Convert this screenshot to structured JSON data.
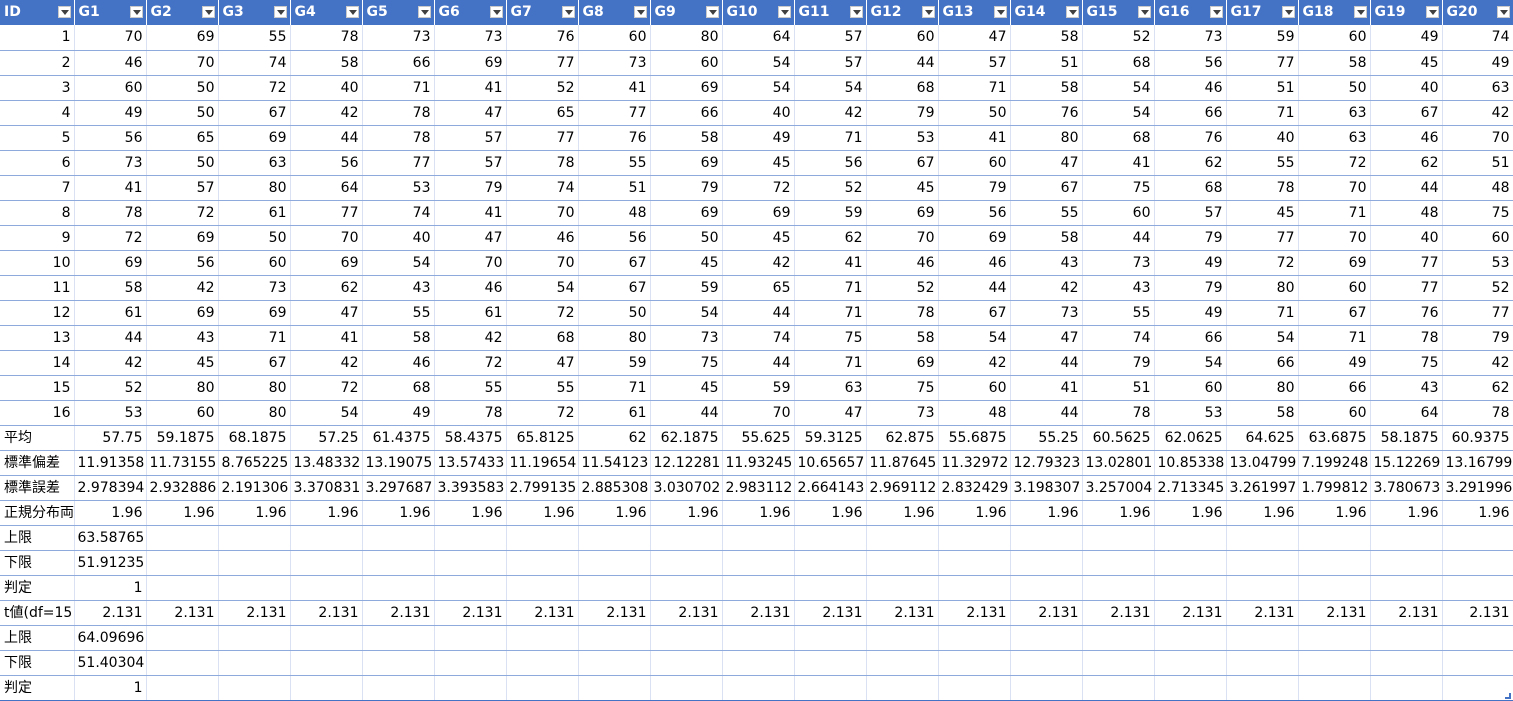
{
  "headers": [
    "ID",
    "G1",
    "G2",
    "G3",
    "G4",
    "G5",
    "G6",
    "G7",
    "G8",
    "G9",
    "G10",
    "G11",
    "G12",
    "G13",
    "G14",
    "G15",
    "G16",
    "G17",
    "G18",
    "G19",
    "G20"
  ],
  "data_rows": [
    [
      "1",
      "70",
      "69",
      "55",
      "78",
      "73",
      "73",
      "76",
      "60",
      "80",
      "64",
      "57",
      "60",
      "47",
      "58",
      "52",
      "73",
      "59",
      "60",
      "49",
      "74"
    ],
    [
      "2",
      "46",
      "70",
      "74",
      "58",
      "66",
      "69",
      "77",
      "73",
      "60",
      "54",
      "57",
      "44",
      "57",
      "51",
      "68",
      "56",
      "77",
      "58",
      "45",
      "49"
    ],
    [
      "3",
      "60",
      "50",
      "72",
      "40",
      "71",
      "41",
      "52",
      "41",
      "69",
      "54",
      "54",
      "68",
      "71",
      "58",
      "54",
      "46",
      "51",
      "50",
      "40",
      "63"
    ],
    [
      "4",
      "49",
      "50",
      "67",
      "42",
      "78",
      "47",
      "65",
      "77",
      "66",
      "40",
      "42",
      "79",
      "50",
      "76",
      "54",
      "66",
      "71",
      "63",
      "67",
      "42"
    ],
    [
      "5",
      "56",
      "65",
      "69",
      "44",
      "78",
      "57",
      "77",
      "76",
      "58",
      "49",
      "71",
      "53",
      "41",
      "80",
      "68",
      "76",
      "40",
      "63",
      "46",
      "70"
    ],
    [
      "6",
      "73",
      "50",
      "63",
      "56",
      "77",
      "57",
      "78",
      "55",
      "69",
      "45",
      "56",
      "67",
      "60",
      "47",
      "41",
      "62",
      "55",
      "72",
      "62",
      "51"
    ],
    [
      "7",
      "41",
      "57",
      "80",
      "64",
      "53",
      "79",
      "74",
      "51",
      "79",
      "72",
      "52",
      "45",
      "79",
      "67",
      "75",
      "68",
      "78",
      "70",
      "44",
      "48"
    ],
    [
      "8",
      "78",
      "72",
      "61",
      "77",
      "74",
      "41",
      "70",
      "48",
      "69",
      "69",
      "59",
      "69",
      "56",
      "55",
      "60",
      "57",
      "45",
      "71",
      "48",
      "75"
    ],
    [
      "9",
      "72",
      "69",
      "50",
      "70",
      "40",
      "47",
      "46",
      "56",
      "50",
      "45",
      "62",
      "70",
      "69",
      "58",
      "44",
      "79",
      "77",
      "70",
      "40",
      "60"
    ],
    [
      "10",
      "69",
      "56",
      "60",
      "69",
      "54",
      "70",
      "70",
      "67",
      "45",
      "42",
      "41",
      "46",
      "46",
      "43",
      "73",
      "49",
      "72",
      "69",
      "77",
      "53"
    ],
    [
      "11",
      "58",
      "42",
      "73",
      "62",
      "43",
      "46",
      "54",
      "67",
      "59",
      "65",
      "71",
      "52",
      "44",
      "42",
      "43",
      "79",
      "80",
      "60",
      "77",
      "52"
    ],
    [
      "12",
      "61",
      "69",
      "69",
      "47",
      "55",
      "61",
      "72",
      "50",
      "54",
      "44",
      "71",
      "78",
      "67",
      "73",
      "55",
      "49",
      "71",
      "67",
      "76",
      "77"
    ],
    [
      "13",
      "44",
      "43",
      "71",
      "41",
      "58",
      "42",
      "68",
      "80",
      "73",
      "74",
      "75",
      "58",
      "54",
      "47",
      "74",
      "66",
      "54",
      "71",
      "78",
      "79"
    ],
    [
      "14",
      "42",
      "45",
      "67",
      "42",
      "46",
      "72",
      "47",
      "59",
      "75",
      "44",
      "71",
      "69",
      "42",
      "44",
      "79",
      "54",
      "66",
      "49",
      "75",
      "42"
    ],
    [
      "15",
      "52",
      "80",
      "80",
      "72",
      "68",
      "55",
      "55",
      "71",
      "45",
      "59",
      "63",
      "75",
      "60",
      "41",
      "51",
      "60",
      "80",
      "66",
      "43",
      "62"
    ],
    [
      "16",
      "53",
      "60",
      "80",
      "54",
      "49",
      "78",
      "72",
      "61",
      "44",
      "70",
      "47",
      "73",
      "48",
      "44",
      "78",
      "53",
      "58",
      "60",
      "64",
      "78"
    ]
  ],
  "stat_rows": [
    [
      "平均",
      "57.75",
      "59.1875",
      "68.1875",
      "57.25",
      "61.4375",
      "58.4375",
      "65.8125",
      "62",
      "62.1875",
      "55.625",
      "59.3125",
      "62.875",
      "55.6875",
      "55.25",
      "60.5625",
      "62.0625",
      "64.625",
      "63.6875",
      "58.1875",
      "60.9375"
    ],
    [
      "標準偏差",
      "11.91358",
      "11.73155",
      "8.765225",
      "13.48332",
      "13.19075",
      "13.57433",
      "11.19654",
      "11.54123",
      "12.12281",
      "11.93245",
      "10.65657",
      "11.87645",
      "11.32972",
      "12.79323",
      "13.02801",
      "10.85338",
      "13.04799",
      "7.199248",
      "15.12269",
      "13.16799"
    ],
    [
      "標準誤差",
      "2.978394",
      "2.932886",
      "2.191306",
      "3.370831",
      "3.297687",
      "3.393583",
      "2.799135",
      "2.885308",
      "3.030702",
      "2.983112",
      "2.664143",
      "2.969112",
      "2.832429",
      "3.198307",
      "3.257004",
      "2.713345",
      "3.261997",
      "1.799812",
      "3.780673",
      "3.291996"
    ],
    [
      "正規分布両",
      "1.96",
      "1.96",
      "1.96",
      "1.96",
      "1.96",
      "1.96",
      "1.96",
      "1.96",
      "1.96",
      "1.96",
      "1.96",
      "1.96",
      "1.96",
      "1.96",
      "1.96",
      "1.96",
      "1.96",
      "1.96",
      "1.96",
      "1.96"
    ],
    [
      "上限",
      "63.58765",
      "",
      "",
      "",
      "",
      "",
      "",
      "",
      "",
      "",
      "",
      "",
      "",
      "",
      "",
      "",
      "",
      "",
      "",
      ""
    ],
    [
      "下限",
      "51.91235",
      "",
      "",
      "",
      "",
      "",
      "",
      "",
      "",
      "",
      "",
      "",
      "",
      "",
      "",
      "",
      "",
      "",
      "",
      ""
    ],
    [
      "判定",
      "1",
      "",
      "",
      "",
      "",
      "",
      "",
      "",
      "",
      "",
      "",
      "",
      "",
      "",
      "",
      "",
      "",
      "",
      "",
      ""
    ],
    [
      "t値(df=15",
      "2.131",
      "2.131",
      "2.131",
      "2.131",
      "2.131",
      "2.131",
      "2.131",
      "2.131",
      "2.131",
      "2.131",
      "2.131",
      "2.131",
      "2.131",
      "2.131",
      "2.131",
      "2.131",
      "2.131",
      "2.131",
      "2.131",
      "2.131"
    ],
    [
      "上限",
      "64.09696",
      "",
      "",
      "",
      "",
      "",
      "",
      "",
      "",
      "",
      "",
      "",
      "",
      "",
      "",
      "",
      "",
      "",
      "",
      ""
    ],
    [
      "下限",
      "51.40304",
      "",
      "",
      "",
      "",
      "",
      "",
      "",
      "",
      "",
      "",
      "",
      "",
      "",
      "",
      "",
      "",
      "",
      "",
      ""
    ],
    [
      "判定",
      "1",
      "",
      "",
      "",
      "",
      "",
      "",
      "",
      "",
      "",
      "",
      "",
      "",
      "",
      "",
      "",
      "",
      "",
      "",
      ""
    ]
  ],
  "colors": {
    "header_bg": "#4472c4",
    "row_border": "#8ea9db",
    "header_text": "#ffffff"
  }
}
